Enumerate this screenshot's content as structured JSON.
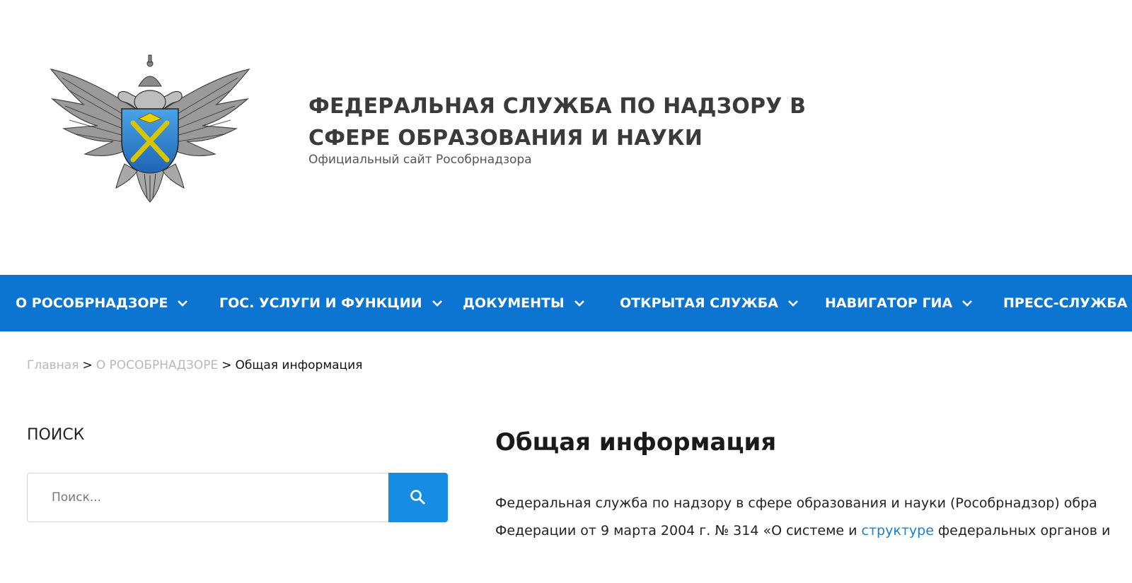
{
  "header": {
    "logo_name": "rosobrnadzor-emblem",
    "title_line1": "ФЕДЕРАЛЬНАЯ СЛУЖБА ПО НАДЗОРУ В",
    "title_line2": "СФЕРЕ ОБРАЗОВАНИЯ И НАУКИ",
    "subtitle": "Официальный сайт Рособрнадзора"
  },
  "nav": {
    "background": "#0b75d1",
    "items": [
      {
        "label": "О РОСОБРНАДЗОРЕ",
        "icon": "chevron-down-icon"
      },
      {
        "label": "ГОС. УСЛУГИ И ФУНКЦИИ",
        "icon": "chevron-down-icon"
      },
      {
        "label": "ДОКУМЕНТЫ",
        "icon": "chevron-down-icon"
      },
      {
        "label": "ОТКРЫТАЯ СЛУЖБА",
        "icon": "chevron-down-icon"
      },
      {
        "label": "НАВИГАТОР ГИА",
        "icon": "chevron-down-icon"
      },
      {
        "label": "ПРЕСС-СЛУЖБА",
        "icon": "chevron-down-icon"
      }
    ]
  },
  "breadcrumb": {
    "home": "Главная",
    "separator": ">",
    "section": "О РОСОБРНАДЗОРЕ",
    "current": "Общая информация"
  },
  "sidebar": {
    "search_heading": "ПОИСК",
    "search_placeholder": "Поиск...",
    "search_icon": "search-icon",
    "search_button_color": "#168de2"
  },
  "main": {
    "heading": "Общая информация",
    "line1": "Федеральная служба по надзору в сфере образования и науки (Рособрнадзор) обра",
    "line2_before": "Федерации от 9 марта 2004 г. № 314 «О системе и ",
    "line2_link": "структуре",
    "line2_after": " федеральных органов и",
    "link_color": "#1a7fd0"
  }
}
